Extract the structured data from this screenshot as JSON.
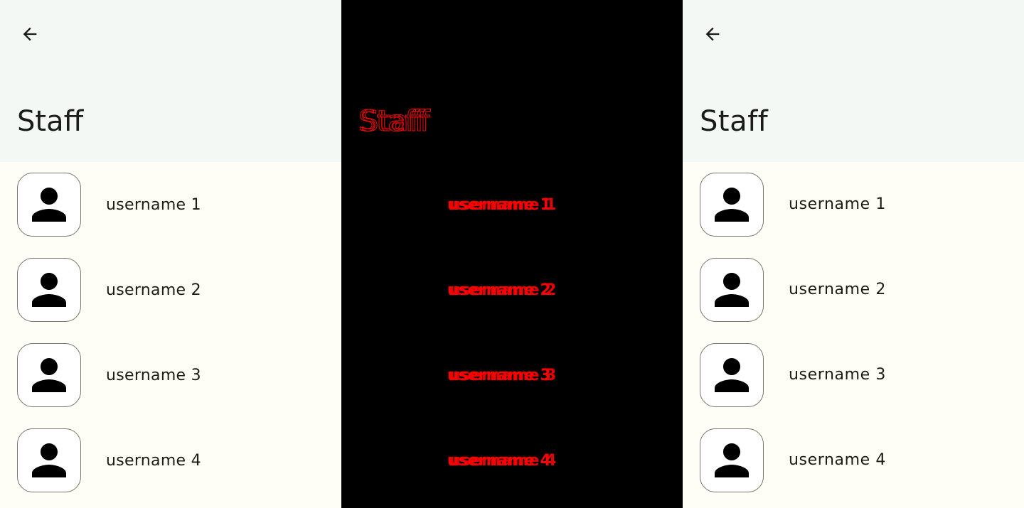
{
  "screen": {
    "title": "Staff",
    "back_icon": "arrow-back-icon",
    "avatar_icon": "person-icon",
    "users": [
      {
        "name": "username 1"
      },
      {
        "name": "username 2"
      },
      {
        "name": "username 3"
      },
      {
        "name": "username 4"
      }
    ]
  },
  "colors": {
    "app_bar_bg": "#f4f8f5",
    "content_bg": "#fefef6",
    "text": "#1b1c18",
    "avatar_border": "#75776f",
    "overlay_bg": "#000000",
    "overlay_text": "#ff0000"
  }
}
